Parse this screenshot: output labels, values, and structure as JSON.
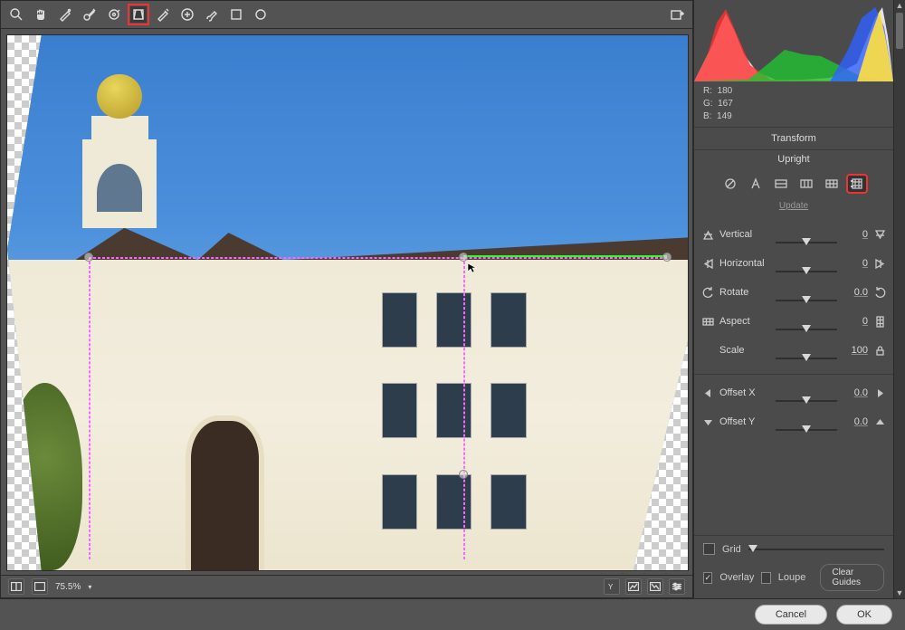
{
  "toolbar_tools": [
    "zoom",
    "hand",
    "white-balance",
    "color-sampler",
    "target-adjust",
    "crop",
    "spot-removal",
    "redeye",
    "brush",
    "gradient",
    "radial"
  ],
  "toolbar_selected_index": 5,
  "rgb": {
    "R": 180,
    "G": 167,
    "B": 149
  },
  "panel": {
    "title": "Transform",
    "subtitle": "Upright",
    "update": "Update"
  },
  "upright_modes": [
    "off",
    "auto",
    "level",
    "vertical",
    "full",
    "guided"
  ],
  "upright_selected_index": 5,
  "sliders": [
    {
      "label": "Vertical",
      "value": "0",
      "pos": 50,
      "pre": "pv-top",
      "post": "pv-bottom"
    },
    {
      "label": "Horizontal",
      "value": "0",
      "pos": 50,
      "pre": "ph-left",
      "post": "ph-right"
    },
    {
      "label": "Rotate",
      "value": "0.0",
      "pos": 50,
      "pre": "rot-ccw",
      "post": "rot-cw"
    },
    {
      "label": "Aspect",
      "value": "0",
      "pos": 50,
      "pre": "grid-h",
      "post": "grid-v"
    },
    {
      "label": "Scale",
      "value": "100",
      "pos": 50,
      "pre": "",
      "post": "lock"
    }
  ],
  "offset": [
    {
      "label": "Offset X",
      "value": "0.0",
      "pos": 50,
      "pre": "arrow-left",
      "post": "arrow-right"
    },
    {
      "label": "Offset Y",
      "value": "0.0",
      "pos": 50,
      "pre": "arrow-down",
      "post": "arrow-up"
    }
  ],
  "gridRow": {
    "label": "Grid",
    "checked": false
  },
  "overlay": {
    "overlay_label": "Overlay",
    "overlay_checked": true,
    "loupe_label": "Loupe",
    "loupe_checked": false,
    "clear": "Clear Guides"
  },
  "zoom": "75.5%",
  "footer": {
    "cancel": "Cancel",
    "ok": "OK"
  }
}
